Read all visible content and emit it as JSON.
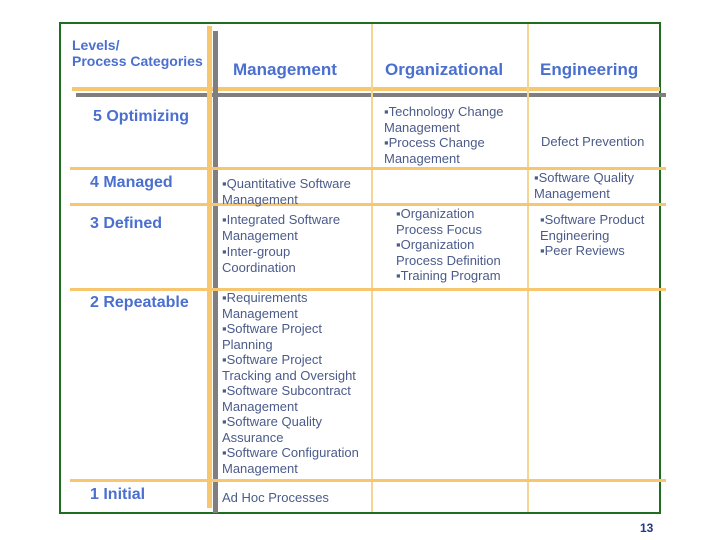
{
  "header": {
    "corner_line1": "Levels/",
    "corner_line2": "Process Categories",
    "columns": [
      "Management",
      "Organizational",
      "Engineering"
    ]
  },
  "levels": [
    {
      "name": "5 Optimizing",
      "management": [],
      "organizational": [
        "▪Technology Change Management",
        "▪Process Change Management"
      ],
      "engineering": [
        "Defect Prevention"
      ]
    },
    {
      "name": "4 Managed",
      "management": [
        "▪Quantitative Software Management"
      ],
      "organizational": [],
      "engineering": [
        "▪Software Quality Management"
      ]
    },
    {
      "name": "3 Defined",
      "management": [
        "▪Integrated Software Management",
        "▪Inter-group Coordination"
      ],
      "organizational": [
        "▪Organization Process Focus",
        "▪Organization Process Definition",
        "▪Training Program"
      ],
      "engineering": [
        "▪Software Product Engineering",
        "▪Peer Reviews"
      ]
    },
    {
      "name": "2 Repeatable",
      "management": [
        "▪Requirements Management",
        "▪Software Project Planning",
        "▪Software Project Tracking and Oversight",
        "▪Software Subcontract Management",
        "▪Software Quality Assurance",
        "▪Software Configuration Management"
      ],
      "organizational": [],
      "engineering": []
    },
    {
      "name": "1 Initial",
      "management": [
        "Ad Hoc Processes"
      ],
      "organizational": [],
      "engineering": []
    }
  ],
  "page_number": "13",
  "colors": {
    "heading_blue": "#4a6fcf",
    "body_text": "#4b5b8a",
    "border_green": "#1f6e1f",
    "grid_orange": "#f7c66e",
    "grid_gray": "#7f7f7f"
  }
}
